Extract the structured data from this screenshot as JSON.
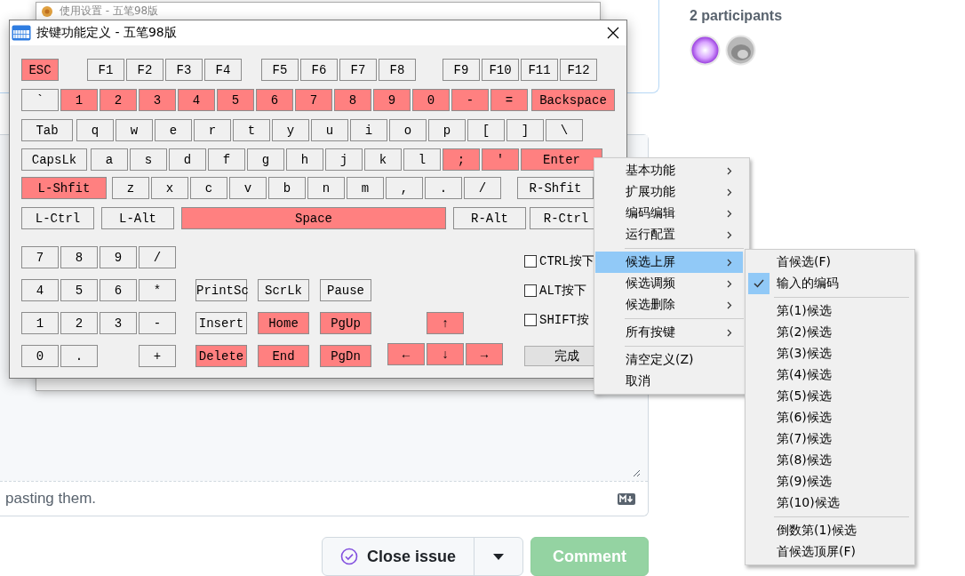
{
  "page": {
    "participants_label": "2 participants",
    "avatars": [
      {
        "kind": "orb"
      },
      {
        "kind": "cat"
      }
    ],
    "comment_hint": "pasting them.",
    "close_issue_button": "Close issue",
    "comment_button": "Comment"
  },
  "background_window": {
    "title": "使用设置 - 五笔98版"
  },
  "key_dialog": {
    "title": "按键功能定义 - 五笔98版",
    "rows": [
      {
        "keys": [
          {
            "label": "ESC",
            "highlighted": true
          },
          {
            "label": "F1",
            "highlighted": false
          },
          {
            "label": "F2",
            "highlighted": false
          },
          {
            "label": "F3",
            "highlighted": false
          },
          {
            "label": "F4",
            "highlighted": false
          },
          {
            "label": "F5",
            "highlighted": false
          },
          {
            "label": "F6",
            "highlighted": false
          },
          {
            "label": "F7",
            "highlighted": false
          },
          {
            "label": "F8",
            "highlighted": false
          },
          {
            "label": "F9",
            "highlighted": false
          },
          {
            "label": "F10",
            "highlighted": false
          },
          {
            "label": "F11",
            "highlighted": false
          },
          {
            "label": "F12",
            "highlighted": false
          }
        ]
      },
      {
        "keys": [
          {
            "label": "`",
            "highlighted": false
          },
          {
            "label": "1",
            "highlighted": true
          },
          {
            "label": "2",
            "highlighted": true
          },
          {
            "label": "3",
            "highlighted": true
          },
          {
            "label": "4",
            "highlighted": true
          },
          {
            "label": "5",
            "highlighted": true
          },
          {
            "label": "6",
            "highlighted": true
          },
          {
            "label": "7",
            "highlighted": true
          },
          {
            "label": "8",
            "highlighted": true
          },
          {
            "label": "9",
            "highlighted": true
          },
          {
            "label": "0",
            "highlighted": true
          },
          {
            "label": "-",
            "highlighted": true
          },
          {
            "label": "=",
            "highlighted": true
          },
          {
            "label": "Backspace",
            "highlighted": true
          }
        ]
      },
      {
        "keys": [
          {
            "label": "Tab",
            "highlighted": false
          },
          {
            "label": "q",
            "highlighted": false
          },
          {
            "label": "w",
            "highlighted": false
          },
          {
            "label": "e",
            "highlighted": false
          },
          {
            "label": "r",
            "highlighted": false
          },
          {
            "label": "t",
            "highlighted": false
          },
          {
            "label": "y",
            "highlighted": false
          },
          {
            "label": "u",
            "highlighted": false
          },
          {
            "label": "i",
            "highlighted": false
          },
          {
            "label": "o",
            "highlighted": false
          },
          {
            "label": "p",
            "highlighted": false
          },
          {
            "label": "[",
            "highlighted": false
          },
          {
            "label": "]",
            "highlighted": false
          },
          {
            "label": "\\",
            "highlighted": false
          }
        ]
      },
      {
        "keys": [
          {
            "label": "CapsLk",
            "highlighted": false
          },
          {
            "label": "a",
            "highlighted": false
          },
          {
            "label": "s",
            "highlighted": false
          },
          {
            "label": "d",
            "highlighted": false
          },
          {
            "label": "f",
            "highlighted": false
          },
          {
            "label": "g",
            "highlighted": false
          },
          {
            "label": "h",
            "highlighted": false
          },
          {
            "label": "j",
            "highlighted": false
          },
          {
            "label": "k",
            "highlighted": false
          },
          {
            "label": "l",
            "highlighted": false
          },
          {
            "label": ";",
            "highlighted": true
          },
          {
            "label": "'",
            "highlighted": true
          },
          {
            "label": "Enter",
            "highlighted": true
          }
        ]
      },
      {
        "keys": [
          {
            "label": "L-Shfit",
            "highlighted": true
          },
          {
            "label": "z",
            "highlighted": false
          },
          {
            "label": "x",
            "highlighted": false
          },
          {
            "label": "c",
            "highlighted": false
          },
          {
            "label": "v",
            "highlighted": false
          },
          {
            "label": "b",
            "highlighted": false
          },
          {
            "label": "n",
            "highlighted": false
          },
          {
            "label": "m",
            "highlighted": false
          },
          {
            "label": ",",
            "highlighted": false
          },
          {
            "label": ".",
            "highlighted": false
          },
          {
            "label": "/",
            "highlighted": false
          },
          {
            "label": "R-Shfit",
            "highlighted": false
          }
        ]
      },
      {
        "keys": [
          {
            "label": "L-Ctrl",
            "highlighted": false
          },
          {
            "label": "L-Alt",
            "highlighted": false
          },
          {
            "label": "Space",
            "highlighted": true
          },
          {
            "label": "R-Alt",
            "highlighted": false
          },
          {
            "label": "R-Ctrl",
            "highlighted": false
          }
        ]
      }
    ],
    "numpad": [
      [
        {
          "label": "7",
          "highlighted": false
        },
        {
          "label": "8",
          "highlighted": false
        },
        {
          "label": "9",
          "highlighted": false
        },
        {
          "label": "/",
          "highlighted": false
        }
      ],
      [
        {
          "label": "4",
          "highlighted": false
        },
        {
          "label": "5",
          "highlighted": false
        },
        {
          "label": "6",
          "highlighted": false
        },
        {
          "label": "*",
          "highlighted": false
        }
      ],
      [
        {
          "label": "1",
          "highlighted": false
        },
        {
          "label": "2",
          "highlighted": false
        },
        {
          "label": "3",
          "highlighted": false
        },
        {
          "label": "-",
          "highlighted": false
        }
      ],
      [
        {
          "label": "0",
          "highlighted": false
        },
        {
          "label": ".",
          "highlighted": false
        },
        {
          "label": "+",
          "highlighted": false
        }
      ]
    ],
    "nav": [
      [
        {
          "label": "PrintSc",
          "highlighted": false
        },
        {
          "label": "ScrLk",
          "highlighted": false
        },
        {
          "label": "Pause",
          "highlighted": false
        }
      ],
      [
        {
          "label": "Insert",
          "highlighted": false
        },
        {
          "label": "Home",
          "highlighted": true
        },
        {
          "label": "PgUp",
          "highlighted": true
        }
      ],
      [
        {
          "label": "Delete",
          "highlighted": true
        },
        {
          "label": "End",
          "highlighted": true
        },
        {
          "label": "PgDn",
          "highlighted": true
        }
      ]
    ],
    "arrows": [
      [
        {
          "label": "↑",
          "highlighted": true
        }
      ],
      [
        {
          "label": "←",
          "highlighted": true
        },
        {
          "label": "↓",
          "highlighted": true
        },
        {
          "label": "→",
          "highlighted": true
        }
      ]
    ],
    "options": [
      {
        "label": "CTRL按下",
        "checked": false
      },
      {
        "label": "ALT按下",
        "checked": false
      },
      {
        "label": "SHIFT按",
        "checked": false
      }
    ],
    "done_button": "完成"
  },
  "context_menu": {
    "items": [
      {
        "kind": "item",
        "label": "基本功能",
        "submenu": true,
        "selected": false
      },
      {
        "kind": "item",
        "label": "扩展功能",
        "submenu": true,
        "selected": false
      },
      {
        "kind": "item",
        "label": "编码编辑",
        "submenu": true,
        "selected": false
      },
      {
        "kind": "item",
        "label": "运行配置",
        "submenu": true,
        "selected": false
      },
      {
        "kind": "separator"
      },
      {
        "kind": "item",
        "label": "候选上屏",
        "submenu": true,
        "selected": true
      },
      {
        "kind": "item",
        "label": "候选调频",
        "submenu": true,
        "selected": false
      },
      {
        "kind": "item",
        "label": "候选删除",
        "submenu": true,
        "selected": false
      },
      {
        "kind": "separator"
      },
      {
        "kind": "item",
        "label": "所有按键",
        "submenu": true,
        "selected": false
      },
      {
        "kind": "separator"
      },
      {
        "kind": "item",
        "label": "清空定义(Z)",
        "submenu": false,
        "selected": false
      },
      {
        "kind": "item",
        "label": "取消",
        "submenu": false,
        "selected": false
      }
    ]
  },
  "submenu": {
    "items": [
      {
        "kind": "item",
        "label": "首候选(F)",
        "checked": false
      },
      {
        "kind": "item",
        "label": "输入的编码",
        "checked": true
      },
      {
        "kind": "separator"
      },
      {
        "kind": "item",
        "label": "第(1)候选",
        "checked": false
      },
      {
        "kind": "item",
        "label": "第(2)候选",
        "checked": false
      },
      {
        "kind": "item",
        "label": "第(3)候选",
        "checked": false
      },
      {
        "kind": "item",
        "label": "第(4)候选",
        "checked": false
      },
      {
        "kind": "item",
        "label": "第(5)候选",
        "checked": false
      },
      {
        "kind": "item",
        "label": "第(6)候选",
        "checked": false
      },
      {
        "kind": "item",
        "label": "第(7)候选",
        "checked": false
      },
      {
        "kind": "item",
        "label": "第(8)候选",
        "checked": false
      },
      {
        "kind": "item",
        "label": "第(9)候选",
        "checked": false
      },
      {
        "kind": "item",
        "label": "第(10)候选",
        "checked": false
      },
      {
        "kind": "separator"
      },
      {
        "kind": "item",
        "label": "倒数第(1)候选",
        "checked": false
      },
      {
        "kind": "item",
        "label": "首候选顶屏(F)",
        "checked": false
      }
    ]
  }
}
